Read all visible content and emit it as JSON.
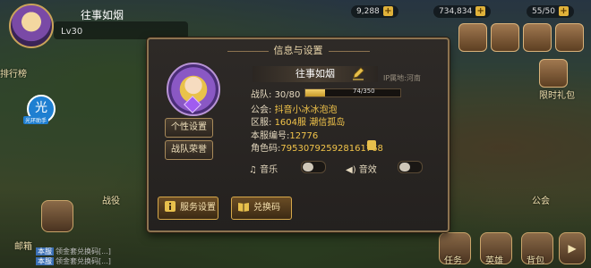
{
  "hud": {
    "player_name": "往事如烟",
    "level": "Lv30",
    "resources": [
      "9,288",
      "734,834",
      "55/50"
    ],
    "side_labels": [
      "排行榜",
      "战役",
      "邮箱",
      "公会",
      "任务",
      "英雄",
      "背包",
      "限时礼包"
    ],
    "badge_label": "光环助手",
    "chat": [
      {
        "tag": "本服",
        "text": "领金套兑换码[...]"
      },
      {
        "tag": "本服",
        "text": "领金套兑换码[...]"
      }
    ]
  },
  "dialog": {
    "title": "信息与设置",
    "player_name": "往事如烟",
    "ip_region": "IP属地:河南",
    "team_label": "战队:",
    "team_value": "30/80",
    "team_xp": "74/350",
    "team_xp_fraction": 0.21,
    "guild_label": "公会:",
    "guild_value": "抖音小冰冰泡泡",
    "server_label": "区服:",
    "server_value": "1604服 潮信孤岛",
    "server_no_label": "本服编号:",
    "server_no_value": "12776",
    "role_code_label": "角色码:",
    "role_code_value": "795307925928161768",
    "btn_personal": "个性设置",
    "btn_team_honor": "战队荣誉",
    "music_label": "音乐",
    "sfx_label": "音效",
    "btn_service": "服务设置",
    "btn_redeem": "兑换码"
  },
  "colors": {
    "accent_gold": "#f2c44a",
    "panel_border": "#8c7350",
    "button_border": "#d7a94a"
  },
  "icons": [
    "edit-icon",
    "copy-icon",
    "music-note-icon",
    "speaker-icon",
    "info-icon",
    "book-icon"
  ]
}
